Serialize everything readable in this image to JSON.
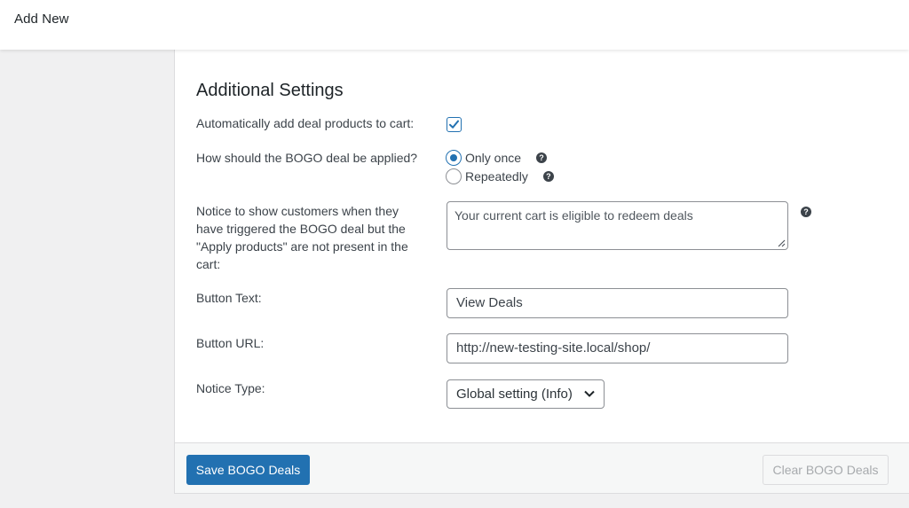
{
  "header": {
    "title": "Add New"
  },
  "settings": {
    "section_title": "Additional Settings",
    "auto_add": {
      "label": "Automatically add deal products to cart:",
      "checked": true
    },
    "apply_mode": {
      "label": "How should the BOGO deal be applied?",
      "options": [
        {
          "label": "Only once",
          "selected": true
        },
        {
          "label": "Repeatedly",
          "selected": false
        }
      ]
    },
    "notice": {
      "label": "Notice to show customers when they have triggered the BOGO deal but the \"Apply products\" are not present in the cart:",
      "value": "Your current cart is eligible to redeem deals"
    },
    "button_text": {
      "label": "Button Text:",
      "value": "View Deals"
    },
    "button_url": {
      "label": "Button URL:",
      "value": "http://new-testing-site.local/shop/"
    },
    "notice_type": {
      "label": "Notice Type:",
      "value": "Global setting (Info)"
    }
  },
  "footer": {
    "save_label": "Save BOGO Deals",
    "clear_label": "Clear BOGO Deals"
  },
  "icons": {
    "help": "help-icon",
    "check": "checkmark-icon",
    "dropdown": "chevron-down-icon"
  },
  "colors": {
    "accent": "#2271b1",
    "text": "#3c434a",
    "disabled": "#a7aaad"
  }
}
